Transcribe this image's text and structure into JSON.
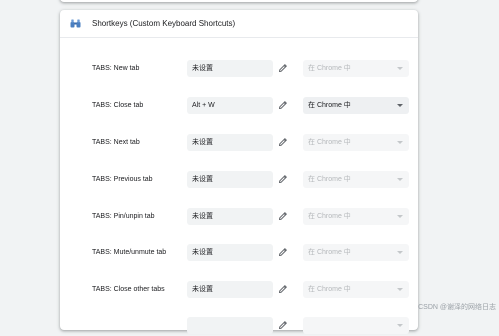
{
  "extension": {
    "title": "Shortkeys (Custom Keyboard Shortcuts)",
    "icon": "binoculars-icon"
  },
  "commands": [
    {
      "label": "TABS: New tab",
      "shortcut": "未设置",
      "scope": "在 Chrome 中",
      "scope_enabled": false
    },
    {
      "label": "TABS: Close tab",
      "shortcut": "Alt + W",
      "scope": "在 Chrome 中",
      "scope_enabled": true
    },
    {
      "label": "TABS: Next tab",
      "shortcut": "未设置",
      "scope": "在 Chrome 中",
      "scope_enabled": false
    },
    {
      "label": "TABS: Previous tab",
      "shortcut": "未设置",
      "scope": "在 Chrome 中",
      "scope_enabled": false
    },
    {
      "label": "TABS: Pin/unpin tab",
      "shortcut": "未设置",
      "scope": "在 Chrome 中",
      "scope_enabled": false
    },
    {
      "label": "TABS: Mute/unmute tab",
      "shortcut": "未设置",
      "scope": "在 Chrome 中",
      "scope_enabled": false
    },
    {
      "label": "TABS: Close other tabs",
      "shortcut": "未设置",
      "scope": "在 Chrome 中",
      "scope_enabled": false
    },
    {
      "label": "",
      "shortcut": "",
      "scope": "",
      "scope_enabled": false
    }
  ],
  "watermark": "CSDN @谢泽的网络日志",
  "colors": {
    "card_background": "#ffffff",
    "page_background": "#f1f3f4",
    "field_background": "#f1f3f4",
    "disabled_text": "#b5b8bb",
    "text": "#202124",
    "icon_blue": "#4a7fc1"
  }
}
